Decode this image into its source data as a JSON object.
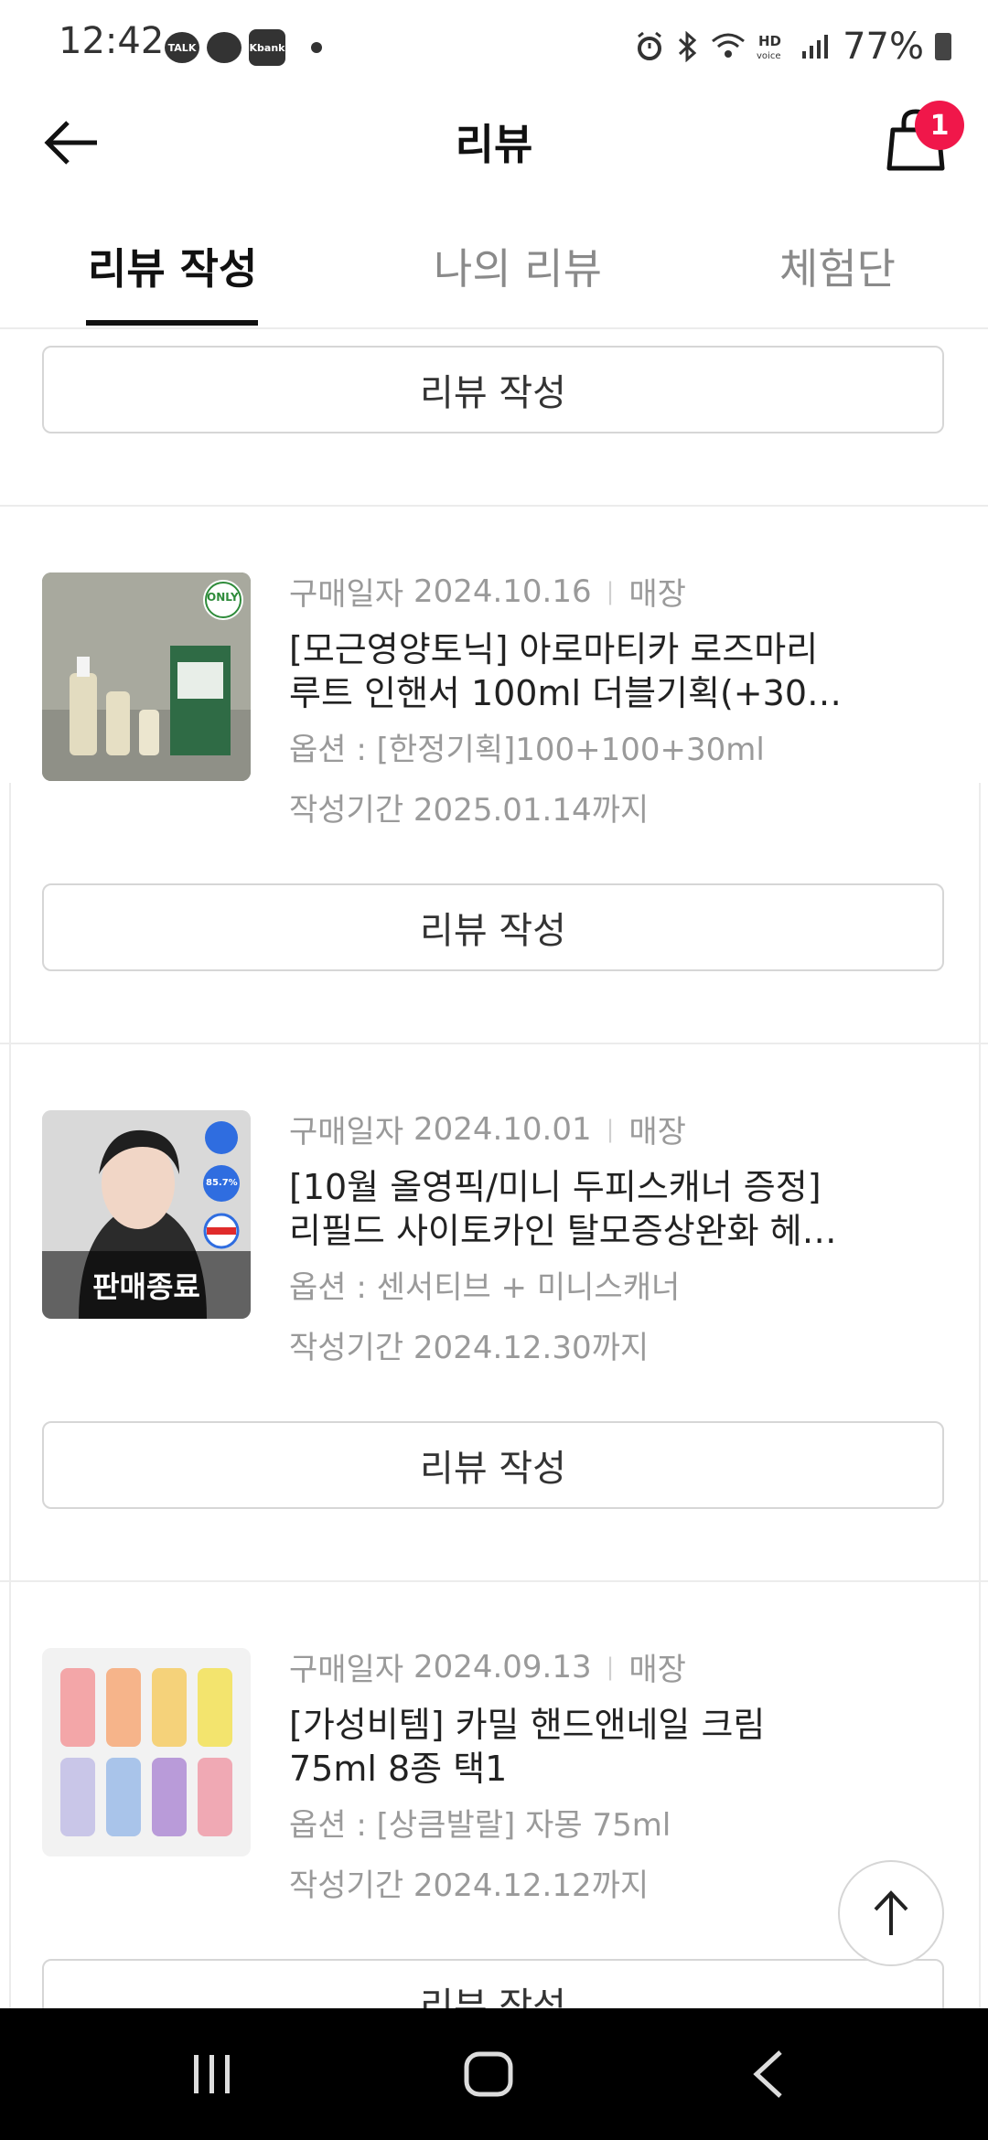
{
  "status_bar": {
    "time": "12:42",
    "left_icons": [
      "TALK",
      "Kbank"
    ],
    "battery_percent": "77%"
  },
  "header": {
    "title": "리뷰",
    "cart_count": "1"
  },
  "tabs": [
    {
      "label": "리뷰 작성",
      "active": true
    },
    {
      "label": "나의 리뷰",
      "active": false
    },
    {
      "label": "체험단",
      "active": false
    }
  ],
  "top_partial_button": {
    "label": "리뷰 작성"
  },
  "items": [
    {
      "purchase_label": "구매일자",
      "purchase_date": "2024.10.16",
      "channel": "매장",
      "name_line1": "[모근영양토닉] 아로마티카 로즈마리",
      "name_line2": "루트 인핸서 100ml 더블기획(+30m…",
      "option": "옵션 : [한정기획]100+100+30ml",
      "deadline": "작성기간 2025.01.14까지",
      "button_label": "리뷰 작성",
      "thumb_badge": "ONLY",
      "sold_out": ""
    },
    {
      "purchase_label": "구매일자",
      "purchase_date": "2024.10.01",
      "channel": "매장",
      "name_line1": "[10월 올영픽/미니 두피스캐너 증정]",
      "name_line2": "리필드 사이토카인 탈모증상완화 헤…",
      "option": "옵션 : 센서티브 + 미니스캐너",
      "deadline": "작성기간 2024.12.30까지",
      "button_label": "리뷰 작성",
      "thumb_badge": "85.7%",
      "sold_out": "판매종료"
    },
    {
      "purchase_label": "구매일자",
      "purchase_date": "2024.09.13",
      "channel": "매장",
      "name_line1": "[가성비템] 카밀 핸드앤네일 크림",
      "name_line2": "75ml 8종 택1",
      "option": "옵션 : [상큼발랄] 자몽 75ml",
      "deadline": "작성기간 2024.12.12까지",
      "button_label": "리뷰 작성",
      "thumb_badge": "",
      "sold_out": ""
    }
  ],
  "colors": {
    "badge": "#f0174a",
    "text_primary": "#222222",
    "text_muted": "#9a9a9a",
    "border": "#d6d6d6"
  },
  "icons": [
    "back-arrow-icon",
    "shopping-bag-icon",
    "arrow-up-icon",
    "recent-apps-icon",
    "home-icon",
    "nav-back-icon"
  ]
}
